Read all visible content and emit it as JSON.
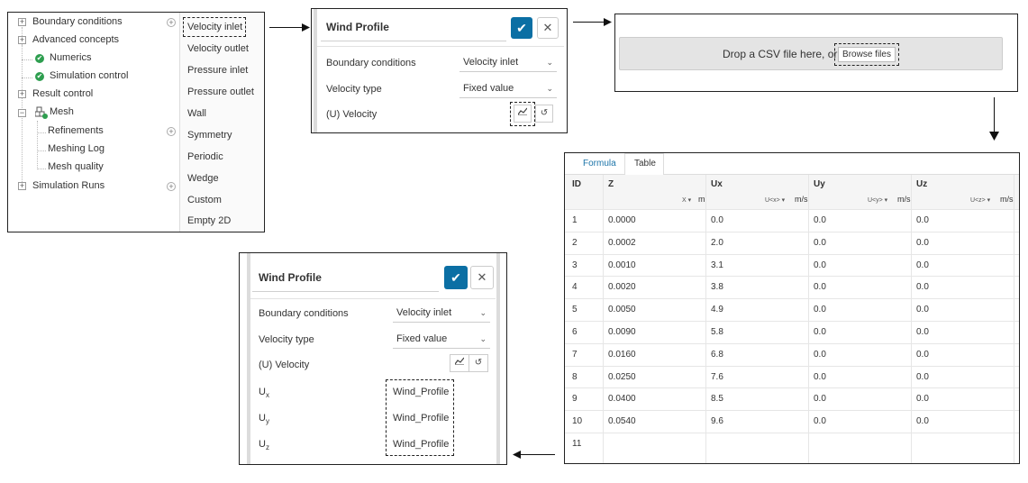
{
  "tree": {
    "items": [
      {
        "label": "Boundary conditions"
      },
      {
        "label": "Advanced concepts"
      },
      {
        "label": "Numerics"
      },
      {
        "label": "Simulation control"
      },
      {
        "label": "Result control"
      },
      {
        "label": "Mesh"
      },
      {
        "label": "Refinements"
      },
      {
        "label": "Meshing Log"
      },
      {
        "label": "Mesh quality"
      },
      {
        "label": "Simulation Runs"
      }
    ]
  },
  "bc_menu": {
    "items": [
      "Velocity inlet",
      "Velocity outlet",
      "Pressure inlet",
      "Pressure outlet",
      "Wall",
      "Symmetry",
      "Periodic",
      "Wedge",
      "Custom",
      "Empty 2D"
    ]
  },
  "wind_profile_top": {
    "title": "Wind Profile",
    "boundary_conditions_label": "Boundary conditions",
    "boundary_conditions_value": "Velocity inlet",
    "velocity_type_label": "Velocity type",
    "velocity_type_value": "Fixed value",
    "velocity_label": "(U) Velocity"
  },
  "csv_drop": {
    "text": "Drop a CSV file here, or",
    "browse_label": "Browse files"
  },
  "table": {
    "tabs": [
      "Formula",
      "Table"
    ],
    "active_tab": "Formula",
    "headers": [
      "ID",
      "Z",
      "Ux",
      "Uy",
      "Uz"
    ],
    "units": {
      "z_sel": "X ▾",
      "z_unit": "m",
      "ux_sel": "U<x> ▾",
      "ux_unit": "m/s",
      "uy_sel": "U<y> ▾",
      "uy_unit": "m/s",
      "uz_sel": "U<z> ▾",
      "uz_unit": "m/s"
    },
    "rows": [
      [
        "1",
        "0.0000",
        "0.0",
        "0.0",
        "0.0"
      ],
      [
        "2",
        "0.0002",
        "2.0",
        "0.0",
        "0.0"
      ],
      [
        "3",
        "0.0010",
        "3.1",
        "0.0",
        "0.0"
      ],
      [
        "4",
        "0.0020",
        "3.8",
        "0.0",
        "0.0"
      ],
      [
        "5",
        "0.0050",
        "4.9",
        "0.0",
        "0.0"
      ],
      [
        "6",
        "0.0090",
        "5.8",
        "0.0",
        "0.0"
      ],
      [
        "7",
        "0.0160",
        "6.8",
        "0.0",
        "0.0"
      ],
      [
        "8",
        "0.0250",
        "7.6",
        "0.0",
        "0.0"
      ],
      [
        "9",
        "0.0400",
        "8.5",
        "0.0",
        "0.0"
      ],
      [
        "10",
        "0.0540",
        "9.6",
        "0.0",
        "0.0"
      ],
      [
        "11",
        "",
        "",
        "",
        ""
      ]
    ]
  },
  "wind_profile_bottom": {
    "title": "Wind Profile",
    "boundary_conditions_label": "Boundary conditions",
    "boundary_conditions_value": "Velocity inlet",
    "velocity_type_label": "Velocity type",
    "velocity_type_value": "Fixed value",
    "velocity_label": "(U) Velocity",
    "components": [
      {
        "label": "U",
        "sub": "x",
        "value": "Wind_Profile"
      },
      {
        "label": "U",
        "sub": "y",
        "value": "Wind_Profile"
      },
      {
        "label": "U",
        "sub": "z",
        "value": "Wind_Profile"
      }
    ]
  },
  "icons": {
    "ok": "✔",
    "close": "✕",
    "chevron": "⌄",
    "chart": "📈",
    "reset": "↺",
    "plus": "+",
    "minus": "−",
    "check": "✔"
  },
  "colors": {
    "accent": "#0b6fa4",
    "check_green": "#2e9e4f",
    "tab_active": "#1a73a8"
  }
}
